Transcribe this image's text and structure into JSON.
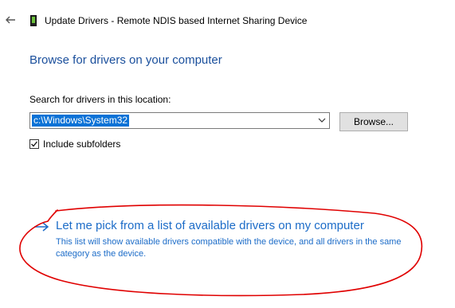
{
  "window": {
    "title": "Update Drivers - Remote NDIS based Internet Sharing Device",
    "back_icon": "back-arrow-icon",
    "device_icon": "device-icon"
  },
  "page": {
    "heading": "Browse for drivers on your computer",
    "search_label": "Search for drivers in this location:",
    "location_value": "c:\\Windows\\System32",
    "browse_label": "Browse...",
    "include_subfolders_label": "Include subfolders",
    "include_subfolders_checked": true
  },
  "pick_option": {
    "link_text": "Let me pick from a list of available drivers on my computer",
    "description": "This list will show available drivers compatible with the device, and all drivers in the same category as the device.",
    "arrow_icon": "arrow-right-icon"
  },
  "colors": {
    "heading": "#1a4f9c",
    "link": "#1c6cc8",
    "selection": "#0a72d6",
    "annotation": "#e00000"
  }
}
